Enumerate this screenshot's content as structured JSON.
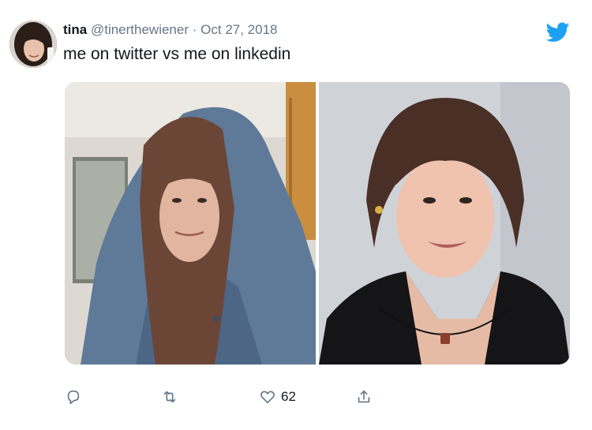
{
  "tweet": {
    "author_name": "tina",
    "author_handle": "@tinerthewiener",
    "separator": "·",
    "date": "Oct 27, 2018",
    "text": "me on twitter vs me on linkedin"
  },
  "icons": {
    "brand": "twitter-bird-icon",
    "reply": "reply-icon",
    "retweet": "retweet-icon",
    "like": "heart-icon",
    "share": "share-icon"
  },
  "colors": {
    "brand_blue": "#1da1f2",
    "text_primary": "#14171a",
    "text_secondary": "#657786"
  },
  "actions": {
    "like_count": "62"
  }
}
